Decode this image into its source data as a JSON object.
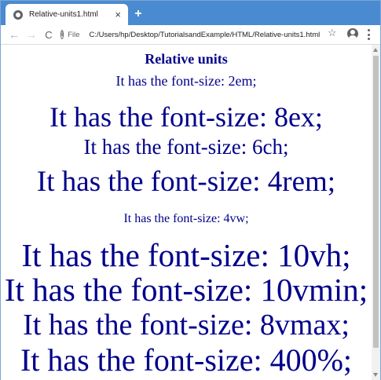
{
  "browser": {
    "tab_title": "Relative-units1.html",
    "tab_close": "×",
    "new_tab": "+",
    "nav": {
      "back": "←",
      "forward": "→",
      "reload": "C"
    },
    "info_icon": "i",
    "scheme_label": "File",
    "url": "C:/Users/hp/Desktop/TutorialsandExample/HTML/Relative-units1.html",
    "bookmark": "☆"
  },
  "page": {
    "heading": "Relative units",
    "lines": [
      "It has the font-size: 2em;",
      "It has the font-size: 8ex;",
      "It has the font-size: 6ch;",
      "It has the font-size: 4rem;",
      "It has the font-size: 4vw;",
      "It has the font-size: 10vh;",
      "It has the font-size: 10vmin;",
      "It has the font-size: 8vmax;",
      "It has the font-size: 400%;"
    ],
    "text_color": "#00008b"
  },
  "colors": {
    "tabstrip": "#4a8ad0",
    "page_text": "#00008b"
  }
}
